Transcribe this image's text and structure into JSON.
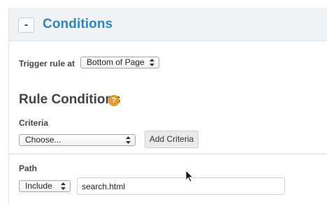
{
  "header": {
    "collapse_label": "-",
    "title": "Conditions"
  },
  "trigger": {
    "label": "Trigger rule at",
    "selected": "Bottom of Page"
  },
  "rule_conditions": {
    "title": "Rule Conditions",
    "help_icon": "?"
  },
  "criteria": {
    "label": "Criteria",
    "selected": "Choose...",
    "add_button": "Add Criteria"
  },
  "path": {
    "label": "Path",
    "match_selected": "Include",
    "value": "search.html"
  },
  "icons": {
    "help": "question-circle-icon",
    "select_arrows": "up-down-arrows-icon",
    "cursor": "mouse-pointer-icon"
  },
  "colors": {
    "title_blue": "#2b87c2",
    "help_orange": "#e69a2b",
    "header_bg": "#eff3f5"
  }
}
